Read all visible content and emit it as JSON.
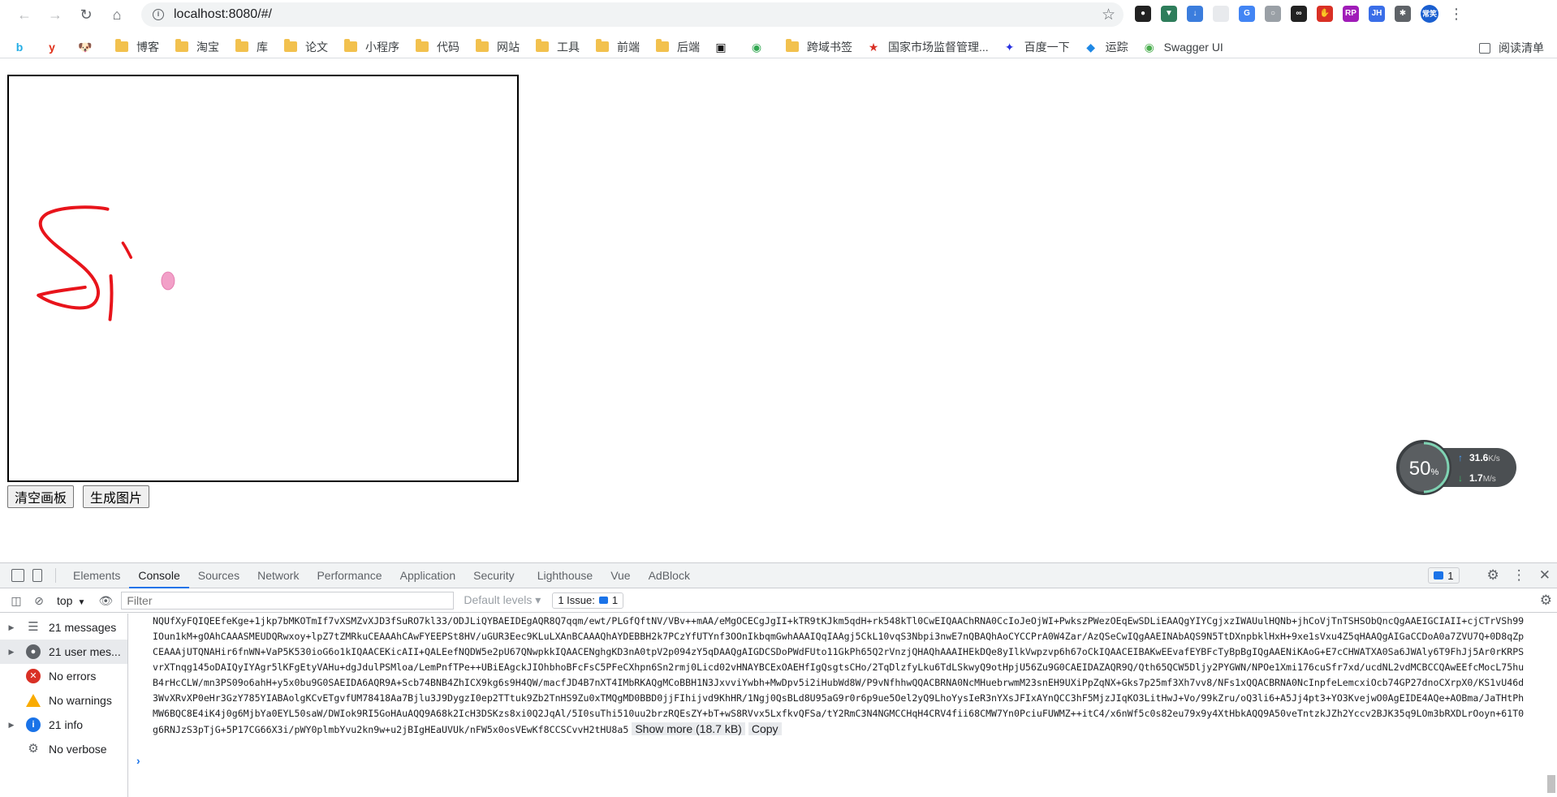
{
  "browser": {
    "url": "localhost:8080/#/",
    "extensions": [
      {
        "name": "extension-bear",
        "color": "#222222",
        "glyph": "●"
      },
      {
        "name": "extension-vue",
        "color": "#2e7d5b",
        "glyph": "▼"
      },
      {
        "name": "extension-download",
        "color": "#3b7ddd",
        "glyph": "↓"
      },
      {
        "name": "extension-blank",
        "color": "#e8eaed",
        "glyph": ""
      },
      {
        "name": "extension-translate",
        "color": "#4285f4",
        "glyph": "G"
      },
      {
        "name": "extension-gray",
        "color": "#9aa0a6",
        "glyph": "○"
      },
      {
        "name": "extension-mask",
        "color": "#222222",
        "glyph": "∞"
      },
      {
        "name": "extension-stop",
        "color": "#d93025",
        "glyph": "✋"
      },
      {
        "name": "extension-rp",
        "color": "#a01cb8",
        "glyph": "RP"
      },
      {
        "name": "extension-jh",
        "color": "#3a6ee8",
        "glyph": "JH"
      },
      {
        "name": "extension-puzzle",
        "color": "#5f6368",
        "glyph": "✱"
      },
      {
        "name": "profile-avatar",
        "color": "#1a5fd0",
        "glyph": "常笑"
      }
    ]
  },
  "bookmarks": {
    "icon_items": [
      {
        "name": "bilibili",
        "color": "#23ade5",
        "glyph": "b"
      },
      {
        "name": "youdao",
        "color": "#e0311a",
        "glyph": "y"
      },
      {
        "name": "dog",
        "color": "#bbbbbb",
        "glyph": "🐶"
      }
    ],
    "folders": [
      "博客",
      "淘宝",
      "库",
      "论文",
      "小程序",
      "代码",
      "网站",
      "工具",
      "前端",
      "后端"
    ],
    "extra": [
      {
        "name": "hack",
        "color": "#111111",
        "glyph": "▣",
        "label": ""
      },
      {
        "name": "round",
        "color": "#32a852",
        "glyph": "◉",
        "label": ""
      },
      {
        "name": "cross-domain",
        "color": "#f2c14e",
        "glyph": "",
        "label": "跨域书签",
        "folder": true
      },
      {
        "name": "samr",
        "color": "#d93025",
        "glyph": "★",
        "label": "国家市场监督管理..."
      },
      {
        "name": "baidu",
        "color": "#2932e1",
        "glyph": "✦",
        "label": "百度一下"
      },
      {
        "name": "track",
        "color": "#1e88e5",
        "glyph": "◆",
        "label": "运踪"
      },
      {
        "name": "swagger",
        "color": "#4caf50",
        "glyph": "◉",
        "label": "Swagger UI"
      }
    ],
    "reading_list": "阅读清单"
  },
  "page": {
    "clear_button": "清空画板",
    "generate_button": "生成图片"
  },
  "net_monitor": {
    "percent": "50",
    "percent_unit": "%",
    "upload": "31.6",
    "upload_unit": "K/s",
    "download": "1.7",
    "download_unit": "M/s"
  },
  "devtools": {
    "tabs": [
      "Elements",
      "Console",
      "Sources",
      "Network",
      "Performance",
      "Application",
      "Security",
      "Lighthouse",
      "Vue",
      "AdBlock"
    ],
    "active_tab": "Console",
    "issues_badge": "1",
    "context": "top",
    "filter_placeholder": "Filter",
    "levels": "Default levels ▾",
    "issues_count_label": "1 Issue:",
    "issues_count": "1",
    "sidebar": [
      {
        "label": "21 messages",
        "icon": "list"
      },
      {
        "label": "21 user mes...",
        "icon": "user"
      },
      {
        "label": "No errors",
        "icon": "err"
      },
      {
        "label": "No warnings",
        "icon": "warn"
      },
      {
        "label": "21 info",
        "icon": "info"
      },
      {
        "label": "No verbose",
        "icon": "verbose"
      }
    ],
    "log_lines": [
      "NQUfXyFQIQEEfeKge+1jkp7bMKOTmIf7vXSMZvXJD3fSuRO7kl33/ODJLiQYBAEIDEgAQR8Q7qqm/ewt/PLGfQftNV/VBv++mAA/eMgOCECgJgII+kTR9tKJkm5qdH+rk548kTl0CwEIQAAChRNA0CcIoJeOjWI+PwkszPWezOEqEwSDLiEAAQgYIYCgjxzIWAUulHQNb+jhCoVjTnTSHSObQncQgAAEIGCIAII+cjCTrVSh99IOun1kM+gOAhCAAASMEUDQRwxoy+lpZ7tZMRkuCEAAAhCAwFYEEPSt8HV/uGUR3Eec9KLuLXAnBCAAAQhAYDEBBH2k7PCzYfUTYnf3OOnIkbqmGwhAAAIQqIAAgj5CkL10vqS3Nbpi3nwE7nQBAQhAoCYCCPrA0W4Zar/AzQSeCwIQgAAEINAbAQS9N5TtDXnpbklHxH+9xe1sVxu4Z5qHAAQgAIGaCCDoA0a7ZVU7Q+0D8qZpCEAAAjUTQNAHir6fnWN+VaP5K530ioG6o1kIQAACEKicAII+QALEefNQDW5e2pU67QNwpkkIQAACENghgKD3nA0tpV2p094zY5qDAAQgAIGDCSDoPWdFUto11GkPh65Q2rVnzjQHAQhAAAIHEkDQe8yIlkVwpzvp6h67oCkIQAACEIBAKwEEvafEYBFcTyBpBgIQgAAENiKAoG+E7cCHWATXA0Sa6JWAly6T9FhJj5Ar0rKRPSvrXTnqg145oDAIQyIYAgr5lKFgEtyVAHu+dgJdulPSMloa/LemPnfTPe++UBiEAgckJIOhbhoBFcFsC5PFeCXhpn6Sn2rmj0Licd02vHNAYBCExOAEHfIgQsgtsCHo/2TqDlzfyLku6TdLSkwyQ9otHpjU56Zu9G0CAEIDAZAQR9Q/Qth65QCW5Dljy2PYGWN/NPOe1Xmi176cuSfr7xd/ucdNL2vdMCBCCQAwEEfcMocL75huB4rHcCLW/mn3PS09o6ahH+y5x0bu9G0SAEIDA6AQR9A+Scb74BNB4ZhICX9kg6s9H4QW/macfJD4B7nXT4IMbRKAQgMCoBBH1N3JxvviYwbh+MwDpv5i2iHubWd8W/P9vNfhhwQQACBRNA0NcMHuebrwmM23snEH9UXiPpZqNX+Gks7p25mf3Xh7vv8/NFs1xQQACBRNA0NcInpfeLemcxiOcb74GP27dnoCXrpX0/KS1vU46d3WvXRvXP0eHr3GzY785YIABAolgKCvETgvfUM78418Aa7Bjlu3J9DygzI0ep2TTtuk9Zb2TnHS9Zu0xTMQgMD0BBD0jjFIhijvd9KhHR/1Ngj0QsBLd8U95aG9r0r6p9ue5Oel2yQ9LhoYysIeR3nYXsJFIxAYnQCC3hF5MjzJIqKO3LitHwJ+Vo/99kZru/oQ3li6+A5Jj4pt3+YO3KvejwO0AgEIDE4AQe+AOBma/JaTHtPhMW6BQC8E4iK4j0g6MjbYa0EYL50saW/DWIok9RI5GoHAuAQQ9A68k2IcH3DSKzs8xi0Q2JqAl/5I0suThi510uu2brzRQEsZY+bT+wS8RVvx5LxfkvQFSa/tY2RmC3N4NGMCCHqH4CRV4fii68CMW7Yn0PciuFUWMZ++itC4/x6nWf5c0s82eu79x9y4XtHbkAQQ9A50veTntzkJZh2Yccv2BJK35q9LOm3bRXDLrOoyn+61T0g6RNJzS3pTjG+5P17CG66X3i/pWY0plmbYvu2kn9w+u2jBIgHEaUVUk/nFW5x0osVEwKf8CCSCvvH2tHU8a5"
    ],
    "show_more": "Show more (18.7 kB)",
    "copy": "Copy"
  },
  "colors": {
    "stroke": "#e8141b",
    "cursor": "#f2a0c8",
    "accent": "#1a73e8"
  }
}
